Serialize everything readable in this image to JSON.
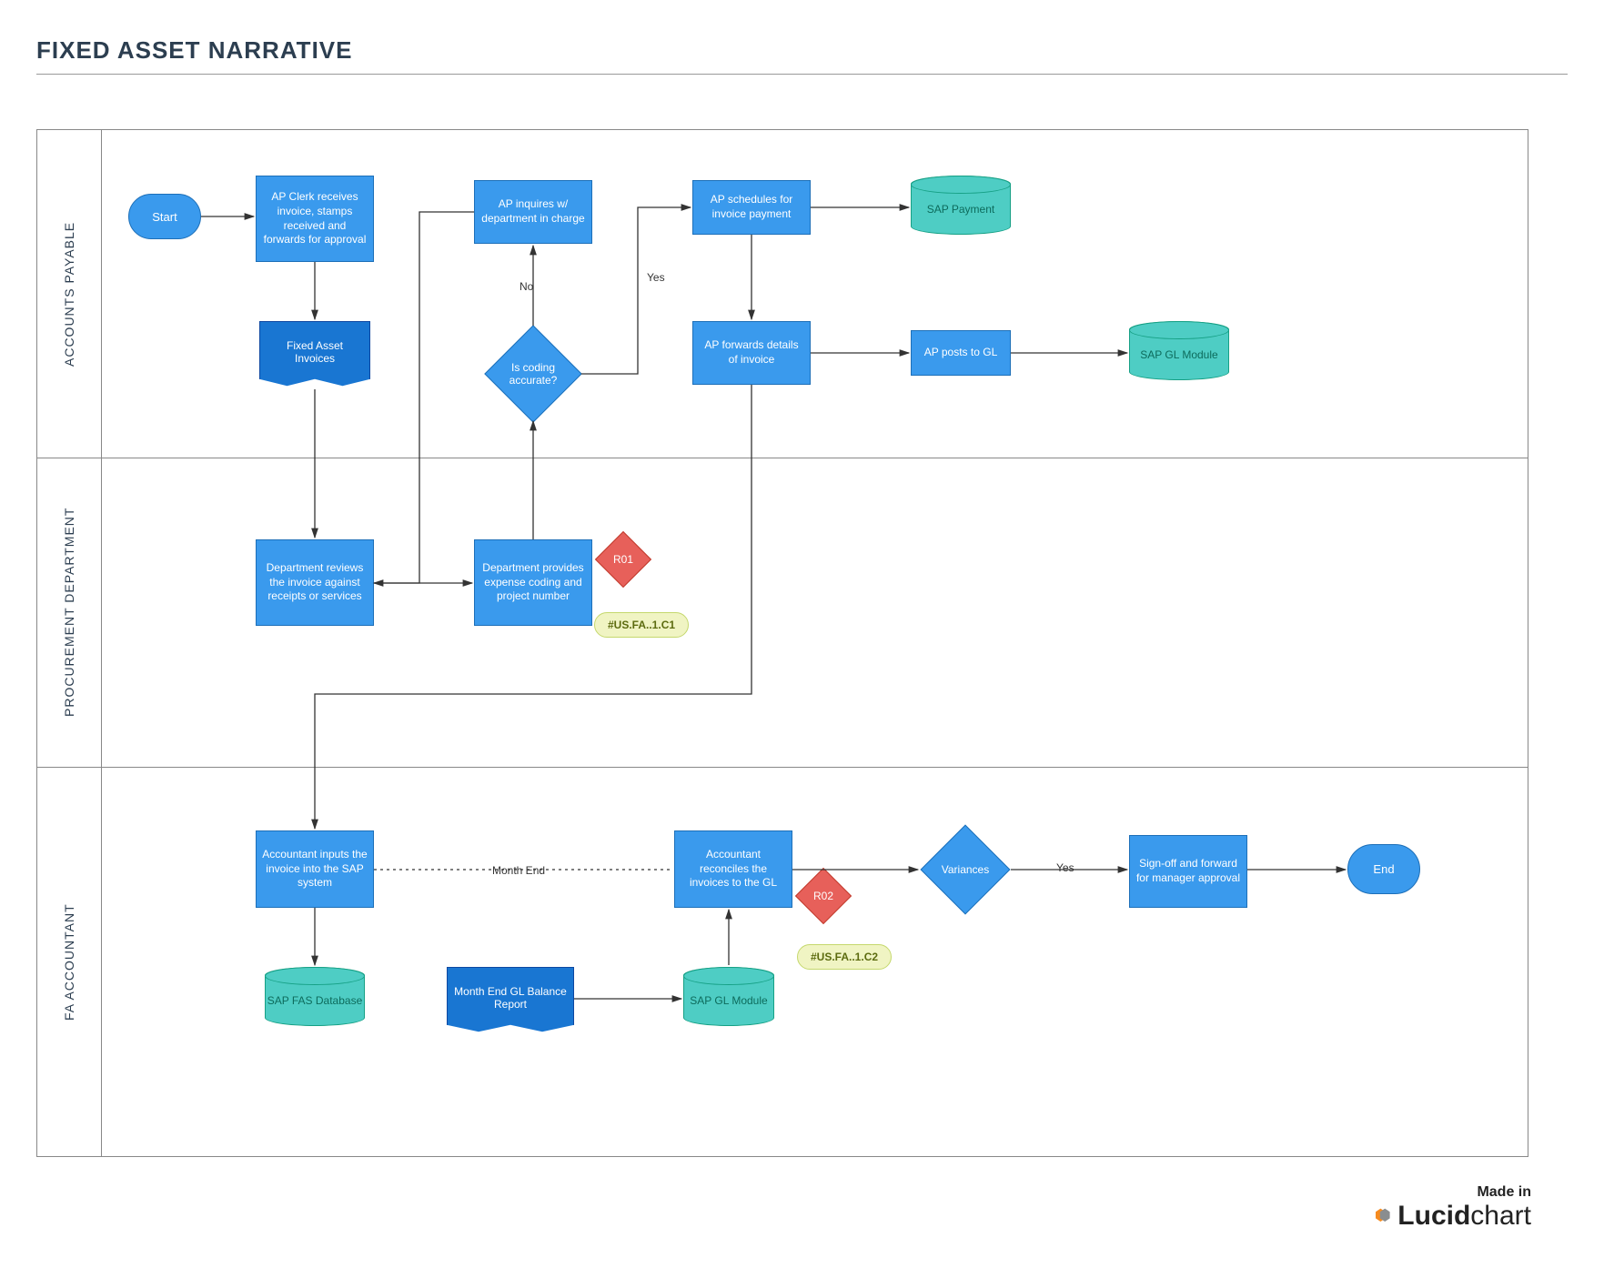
{
  "title": "FIXED ASSET NARRATIVE",
  "lanes": {
    "ap": "ACCOUNTS PAYABLE",
    "proc": "PROCUREMENT DEPARTMENT",
    "fa": "FA ACCOUNTANT"
  },
  "nodes": {
    "start": "Start",
    "ap_receives": "AP Clerk receives invoice, stamps received and forwards for approval",
    "fixed_asset_inv": "Fixed Asset Invoices",
    "ap_inquires": "AP inquires w/ department in charge",
    "coding_accurate": "Is coding accurate?",
    "ap_schedules": "AP schedules for invoice payment",
    "sap_payment": "SAP Payment",
    "ap_forwards": "AP forwards details of invoice",
    "ap_posts_gl": "AP posts to GL",
    "sap_gl_module": "SAP GL Module",
    "dept_reviews": "Department reviews the invoice against receipts or services",
    "dept_provides": "Department provides expense coding and project number",
    "r01": "R01",
    "ref1": "#US.FA..1.C1",
    "acct_inputs": "Accountant inputs the invoice into the SAP system",
    "sap_fas_db": "SAP FAS Database",
    "month_end_report": "Month End GL Balance Report",
    "sap_gl_module2": "SAP GL Module",
    "acct_reconciles": "Accountant reconciles the invoices to the GL",
    "r02": "R02",
    "ref2": "#US.FA..1.C2",
    "variances": "Variances",
    "signoff": "Sign-off and forward for manager approval",
    "end": "End"
  },
  "labels": {
    "no": "No",
    "yes": "Yes",
    "month_end": "Month End",
    "yes2": "Yes"
  },
  "footer": {
    "made": "Made in",
    "brand_bold": "Lucid",
    "brand_light": "chart"
  }
}
